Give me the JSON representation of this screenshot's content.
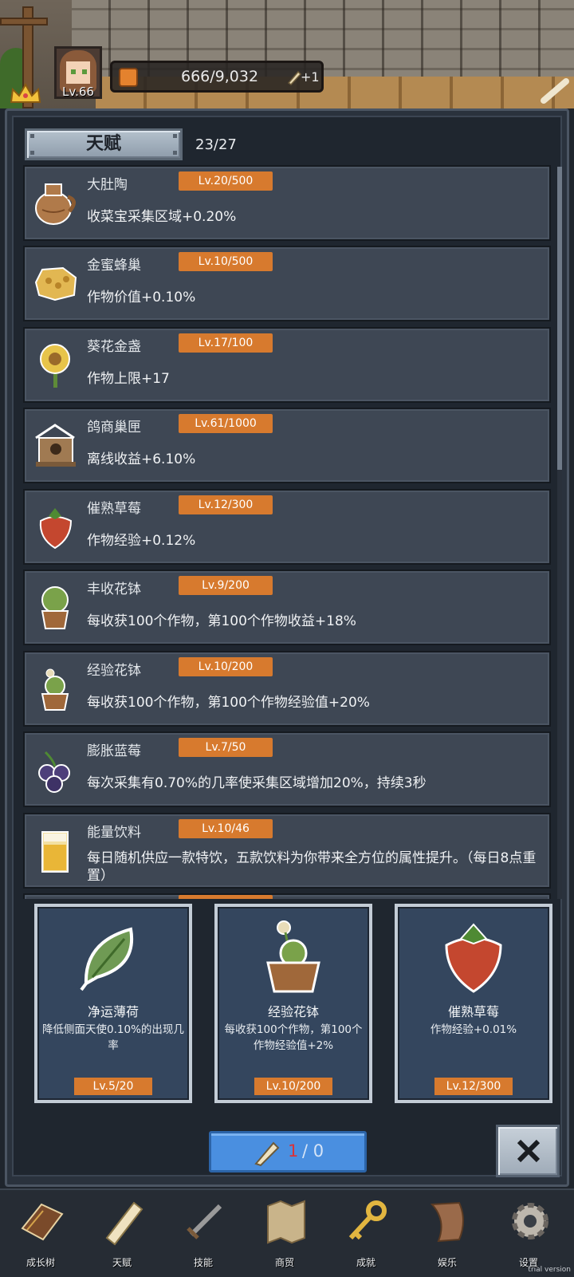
{
  "header": {
    "level": "Lv.66",
    "exp_text": "666/9,032",
    "exp_bonus": "+1"
  },
  "panel": {
    "tab_label": "天赋",
    "count": "23/27"
  },
  "talents": [
    {
      "name": "大肚陶",
      "level": "Lv.20/500",
      "desc": "收菜宝采集区域+0.20%",
      "icon": "clay-pot-icon"
    },
    {
      "name": "金蜜蜂巢",
      "level": "Lv.10/500",
      "desc": "作物价值+0.10%",
      "icon": "honeycomb-icon"
    },
    {
      "name": "葵花金盏",
      "level": "Lv.17/100",
      "desc": "作物上限+17",
      "icon": "sunflower-icon"
    },
    {
      "name": "鸽商巢匣",
      "level": "Lv.61/1000",
      "desc": "离线收益+6.10%",
      "icon": "birdhouse-icon"
    },
    {
      "name": "催熟草莓",
      "level": "Lv.12/300",
      "desc": "作物经验+0.12%",
      "icon": "strawberry-icon"
    },
    {
      "name": "丰收花钵",
      "level": "Lv.9/200",
      "desc": "每收获100个作物，第100个作物收益+18%",
      "icon": "harvest-pot-icon"
    },
    {
      "name": "经验花钵",
      "level": "Lv.10/200",
      "desc": "每收获100个作物，第100个作物经验值+20%",
      "icon": "exp-pot-icon"
    },
    {
      "name": "膨胀蓝莓",
      "level": "Lv.7/50",
      "desc": "每次采集有0.70%的几率使采集区域增加20%，持续3秒",
      "icon": "blueberry-icon"
    },
    {
      "name": "能量饮料",
      "level": "Lv.10/46",
      "desc": "每日随机供应一款特饮，五款饮料为你带来全方位的属性提升。（每日8点重置）",
      "icon": "energy-drink-icon"
    }
  ],
  "selected_cards": [
    {
      "title": "净运薄荷",
      "desc": "降低侧面天使0.10%的出现几率",
      "level": "Lv.5/20",
      "icon": "mint-leaf-icon"
    },
    {
      "title": "经验花钵",
      "desc": "每收获100个作物，第100个作物经验值+2%",
      "level": "Lv.10/200",
      "icon": "exp-pot-icon"
    },
    {
      "title": "催熟草莓",
      "desc": "作物经验+0.01%",
      "level": "Lv.12/300",
      "icon": "strawberry-icon"
    }
  ],
  "use_button": {
    "current": "1",
    "rest": " / 0"
  },
  "nav": [
    {
      "label": "成长树",
      "icon": "book-icon"
    },
    {
      "label": "天赋",
      "icon": "scroll-icon"
    },
    {
      "label": "技能",
      "icon": "sword-icon"
    },
    {
      "label": "商贸",
      "icon": "map-icon"
    },
    {
      "label": "成就",
      "icon": "key-icon"
    },
    {
      "label": "娱乐",
      "icon": "parchment-icon"
    },
    {
      "label": "设置",
      "icon": "gear-icon"
    }
  ],
  "watermark": "trial version",
  "colors": {
    "accent_orange": "#d77a2e",
    "button_blue": "#4a8fe0",
    "panel_bg": "#1f262f",
    "item_bg": "#3e4754",
    "card_bg": "#34465e",
    "count_red": "#d8333a"
  }
}
